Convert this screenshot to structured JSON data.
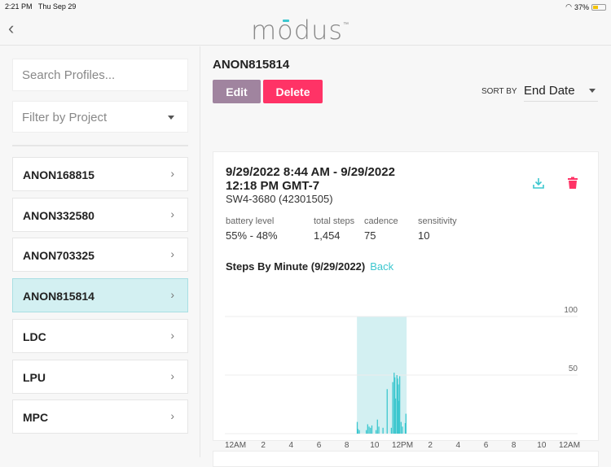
{
  "status": {
    "time": "2:21 PM",
    "date": "Thu Sep 29",
    "battery": "37%",
    "battery_fraction": 0.37
  },
  "header": {
    "logo": "modus",
    "tm": "™"
  },
  "sidebar": {
    "search_placeholder": "Search Profiles...",
    "filter_placeholder": "Filter by Project",
    "items": [
      {
        "label": "ANON168815"
      },
      {
        "label": "ANON332580"
      },
      {
        "label": "ANON703325"
      },
      {
        "label": "ANON815814",
        "selected": true
      },
      {
        "label": "LDC"
      },
      {
        "label": "LPU"
      },
      {
        "label": "MPC"
      }
    ]
  },
  "main": {
    "title": "ANON815814",
    "edit_label": "Edit",
    "delete_label": "Delete",
    "sort_label": "SORT BY",
    "sort_value": "End Date",
    "colors": {
      "edit": "#a0849f",
      "delete": "#ff3366",
      "accent": "#3cc7cf"
    },
    "session": {
      "range_line1": "9/29/2022 8:44 AM - 9/29/2022",
      "range_line2": "12:18 PM GMT-7",
      "device": "SW4-3680 (42301505)",
      "stats": [
        {
          "label": "battery level",
          "value": "55% - 48%"
        },
        {
          "label": "total steps",
          "value": "1,454"
        },
        {
          "label": "cadence",
          "value": "75"
        },
        {
          "label": "sensitivity",
          "value": "10"
        }
      ],
      "chart_title": "Steps By Minute (9/29/2022)",
      "back_label": "Back"
    }
  },
  "chart_data": {
    "type": "bar",
    "title": "Steps By Minute (9/29/2022)",
    "xlabel": "",
    "ylabel": "",
    "xlim": [
      0,
      24
    ],
    "ylim": [
      0,
      100
    ],
    "x_ticks": [
      "12AM",
      "2",
      "4",
      "6",
      "8",
      "10",
      "12PM",
      "2",
      "4",
      "6",
      "8",
      "10",
      "12AM"
    ],
    "y_ticks": [
      {
        "value": 50,
        "label": "50"
      },
      {
        "value": 100,
        "label": "100"
      }
    ],
    "highlight": [
      8.73,
      12.3
    ],
    "x_hours": [
      8.75,
      8.8,
      8.9,
      9.4,
      9.5,
      9.6,
      9.7,
      9.8,
      10.1,
      10.2,
      10.3,
      10.6,
      10.9,
      11.2,
      11.3,
      11.4,
      11.45,
      11.5,
      11.6,
      11.65,
      11.7,
      11.75,
      11.8,
      11.9,
      12.0,
      12.2,
      12.25
    ],
    "values": [
      10,
      4,
      3,
      3,
      8,
      6,
      5,
      7,
      3,
      12,
      6,
      5,
      38,
      5,
      44,
      52,
      48,
      30,
      50,
      47,
      42,
      28,
      49,
      10,
      6,
      9,
      17
    ]
  }
}
